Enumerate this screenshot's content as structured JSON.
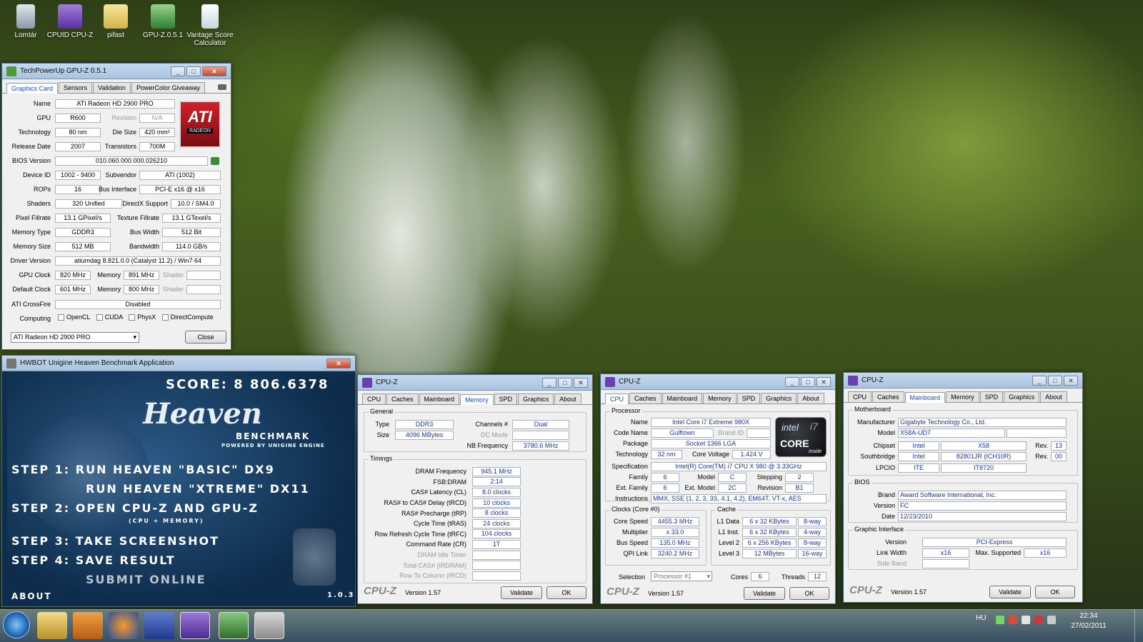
{
  "desktop": {
    "icons": [
      {
        "label": "Lomtár"
      },
      {
        "label": "CPUID CPU-Z"
      },
      {
        "label": "pifast"
      },
      {
        "label": "GPU-Z.0.5.1"
      },
      {
        "label": "Vantage Score Calculator"
      }
    ]
  },
  "gpuz": {
    "title": "TechPowerUp GPU-Z 0.5.1",
    "tabs": [
      "Graphics Card",
      "Sensors",
      "Validation",
      "PowerColor Giveaway"
    ],
    "name": "ATI Radeon HD 2900 PRO",
    "gpu": "R600",
    "revision": "N/A",
    "technology": "80 nm",
    "die_size": "420 mm²",
    "release_date": "2007",
    "transistors": "700M",
    "bios_version": "010.060.000.000.026210",
    "device_id": "1002 - 9400",
    "subvendor": "ATI (1002)",
    "rops": "16",
    "bus_interface": "PCI-E x16 @ x16",
    "shaders": "320 Unified",
    "directx": "10.0 / SM4.0",
    "pixel_fillrate": "13.1 GPixel/s",
    "texture_fillrate": "13.1 GTexel/s",
    "memory_type": "GDDR3",
    "bus_width": "512 Bit",
    "memory_size": "512 MB",
    "bandwidth": "114.0 GB/s",
    "driver_version": "atiumdag 8.821.0.0 (Catalyst 11.2) / Win7 64",
    "gpu_clock": "820 MHz",
    "memory_clock": "891 MHz",
    "default_clock": "601 MHz",
    "default_memory": "800 MHz",
    "crossfire": "Disabled",
    "labels": {
      "name": "Name",
      "gpu": "GPU",
      "revision": "Revision",
      "technology": "Technology",
      "die_size": "Die Size",
      "release_date": "Release Date",
      "transistors": "Transistors",
      "bios": "BIOS Version",
      "device_id": "Device ID",
      "subvendor": "Subvendor",
      "rops": "ROPs",
      "bus_interface": "Bus Interface",
      "shaders": "Shaders",
      "directx": "DirectX Support",
      "pixel_fillrate": "Pixel Fillrate",
      "texture_fillrate": "Texture Fillrate",
      "memory_type": "Memory Type",
      "bus_width": "Bus Width",
      "memory_size": "Memory Size",
      "bandwidth": "Bandwidth",
      "driver": "Driver Version",
      "gpu_clock": "GPU Clock",
      "memory": "Memory",
      "shader": "Shader",
      "default_clock": "Default Clock",
      "crossfire": "ATI CrossFire",
      "computing": "Computing"
    },
    "computing": [
      "OpenCL",
      "CUDA",
      "PhysX",
      "DirectCompute"
    ],
    "logo_text": "ATI",
    "logo_sub": "RADEON",
    "card_select": "ATI Radeon HD 2900 PRO",
    "close": "Close"
  },
  "heaven": {
    "title": "HWBOT Unigine Heaven Benchmark Application",
    "score": "SCORE: 8 806.6378",
    "logo": "Heaven",
    "logo_sub": "BENCHMARK",
    "powered": "POWERED BY UNIGINE ENGINE",
    "step1a": "STEP 1:  RUN HEAVEN \"BASIC\" DX9",
    "step1b": "RUN HEAVEN \"XTREME\" DX11",
    "step2": "STEP 2: OPEN CPU-Z  AND  GPU-Z",
    "step2sub": "(CPU + MEMORY)",
    "step3": "STEP 3: TAKE SCREENSHOT",
    "step4": "STEP 4: SAVE RESULT",
    "step5": "SUBMIT ONLINE",
    "about": "ABOUT",
    "version": "1.0.3"
  },
  "cpuz_tabs": [
    "CPU",
    "Caches",
    "Mainboard",
    "Memory",
    "SPD",
    "Graphics",
    "About"
  ],
  "cpuz_common": {
    "title": "CPU-Z",
    "logo": "CPU-Z",
    "version": "Version 1.57",
    "validate": "Validate",
    "ok": "OK"
  },
  "cpuz_memory": {
    "general": "General",
    "type_label": "Type",
    "type": "DDR3",
    "channels_label": "Channels #",
    "channels": "Dual",
    "size_label": "Size",
    "size": "4096 MBytes",
    "dcmode_label": "DC Mode",
    "nbfreq_label": "NB Frequency",
    "nbfreq": "3780.6 MHz",
    "timings": "Timings",
    "rows": [
      {
        "label": "DRAM Frequency",
        "value": "945.1 MHz"
      },
      {
        "label": "FSB:DRAM",
        "value": "2:14"
      },
      {
        "label": "CAS# Latency (CL)",
        "value": "8.0 clocks"
      },
      {
        "label": "RAS# to CAS# Delay (tRCD)",
        "value": "10 clocks"
      },
      {
        "label": "RAS# Precharge (tRP)",
        "value": "8 clocks"
      },
      {
        "label": "Cycle Time (tRAS)",
        "value": "24 clocks"
      },
      {
        "label": "Row Refresh Cycle Time (tRFC)",
        "value": "104 clocks"
      },
      {
        "label": "Command Rate (CR)",
        "value": "1T"
      },
      {
        "label": "DRAM Idle Timer",
        "value": ""
      },
      {
        "label": "Total CAS# (tRDRAM)",
        "value": ""
      },
      {
        "label": "Row To Column (tRCD)",
        "value": ""
      }
    ]
  },
  "cpuz_cpu": {
    "processor": "Processor",
    "name_label": "Name",
    "name": "Intel Core i7 Extreme 980X",
    "codename_label": "Code Name",
    "codename": "Gulftown",
    "brandid_label": "Brand ID",
    "package_label": "Package",
    "package": "Socket 1366 LGA",
    "tech_label": "Technology",
    "tech": "32 nm",
    "voltage_label": "Core Voltage",
    "voltage": "1.424 V",
    "spec_label": "Specification",
    "spec": "Intel(R) Core(TM) i7 CPU       X 980  @ 3.33GHz",
    "family_label": "Family",
    "family": "6",
    "model_label": "Model",
    "model": "C",
    "stepping_label": "Stepping",
    "stepping": "2",
    "extfamily_label": "Ext. Family",
    "extfamily": "6",
    "extmodel_label": "Ext. Model",
    "extmodel": "2C",
    "revision_label": "Revision",
    "revision": "B1",
    "instr_label": "Instructions",
    "instr": "MMX, SSE (1, 2, 3, 3S, 4.1, 4.2), EM64T, VT-x, AES",
    "clocks": "Clocks (Core #0)",
    "corespeed_label": "Core Speed",
    "corespeed": "4455.3 MHz",
    "mult_label": "Multiplier",
    "mult": "x 33.0",
    "bus_label": "Bus Speed",
    "bus": "135.0 MHz",
    "qpi_label": "QPI Link",
    "qpi": "3240.2 MHz",
    "cache": "Cache",
    "l1d_label": "L1 Data",
    "l1d": "6 x 32 KBytes",
    "l1d_way": "8-way",
    "l1i_label": "L1 Inst.",
    "l1i": "6 x 32 KBytes",
    "l1i_way": "4-way",
    "l2_label": "Level 2",
    "l2": "6 x 256 KBytes",
    "l2_way": "8-way",
    "l3_label": "Level 3",
    "l3": "12 MBytes",
    "l3_way": "16-way",
    "selection_label": "Selection",
    "selection": "Processor #1",
    "cores_label": "Cores",
    "cores": "6",
    "threads_label": "Threads",
    "threads": "12",
    "logo_brand": "intel",
    "logo_core": "CORE",
    "logo_i7": "i7",
    "logo_inside": "inside"
  },
  "cpuz_mb": {
    "motherboard": "Motherboard",
    "manu_label": "Manufacturer",
    "manu": "Gigabyte Technology Co., Ltd.",
    "model_label": "Model",
    "model": "X58A-UD7",
    "chipset_label": "Chipset",
    "chipset_vendor": "Intel",
    "chipset": "X58",
    "rev_label": "Rev.",
    "chipset_rev": "13",
    "south_label": "Southbridge",
    "south_vendor": "Intel",
    "south": "82801JR (ICH10R)",
    "south_rev": "00",
    "lpcio_label": "LPCIO",
    "lpcio_vendor": "ITE",
    "lpcio": "IT8720",
    "bios": "BIOS",
    "brand_label": "Brand",
    "brand": "Award Software International, Inc.",
    "version_label": "Version",
    "version": "FC",
    "date_label": "Date",
    "date": "12/23/2010",
    "graphic": "Graphic Interface",
    "gver_label": "Version",
    "gver": "PCI-Express",
    "lw_label": "Link Width",
    "lw": "x16",
    "max_label": "Max. Supported",
    "max": "x16",
    "side_label": "Side Band"
  },
  "taskbar": {
    "lang": "HU",
    "time": "22:34",
    "date": "27/02/2011"
  }
}
